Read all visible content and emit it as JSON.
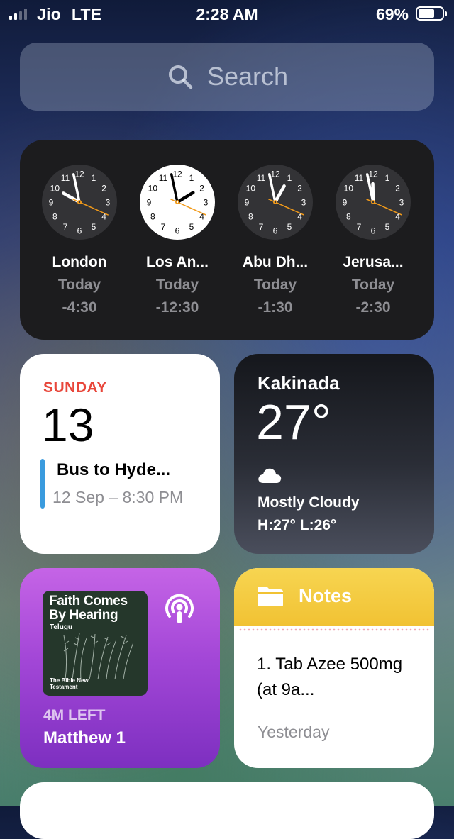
{
  "status_bar": {
    "carrier": "Jio",
    "network": "LTE",
    "time": "2:28 AM",
    "battery_percent": "69%",
    "battery_level": 0.69,
    "signal_bars": 2
  },
  "search": {
    "placeholder": "Search",
    "icon": "search-icon"
  },
  "world_clock": {
    "clocks": [
      {
        "city": "London",
        "day": "Today",
        "offset": "-4:30",
        "hour": 9,
        "minute": 58,
        "second": 19,
        "face": "dark"
      },
      {
        "city": "Los An...",
        "day": "Today",
        "offset": "-12:30",
        "hour": 1,
        "minute": 58,
        "second": 19,
        "face": "light"
      },
      {
        "city": "Abu Dh...",
        "day": "Today",
        "offset": "-1:30",
        "hour": 12,
        "minute": 58,
        "second": 19,
        "face": "dark"
      },
      {
        "city": "Jerusa...",
        "day": "Today",
        "offset": "-2:30",
        "hour": 11,
        "minute": 58,
        "second": 19,
        "face": "dark"
      }
    ]
  },
  "calendar": {
    "weekday": "SUNDAY",
    "day": "13",
    "event_title": "Bus to Hyde...",
    "event_time": "12 Sep – 8:30 PM",
    "accent": "#e8463a",
    "event_color": "#3a9bde"
  },
  "weather": {
    "city": "Kakinada",
    "temperature": "27°",
    "condition": "Mostly Cloudy",
    "high_low": "H:27° L:26°",
    "icon": "cloud-icon"
  },
  "podcast": {
    "cover_title": "Faith Comes By Hearing",
    "cover_subtitle": "Telugu",
    "cover_footer": "The Bible New Testament",
    "time_left": "4M LEFT",
    "episode": "Matthew 1",
    "icon": "podcasts-icon"
  },
  "notes": {
    "title": "Notes",
    "note_text": "1. Tab Azee 500mg (at 9a...",
    "note_date": "Yesterday",
    "icon": "folder-icon"
  }
}
